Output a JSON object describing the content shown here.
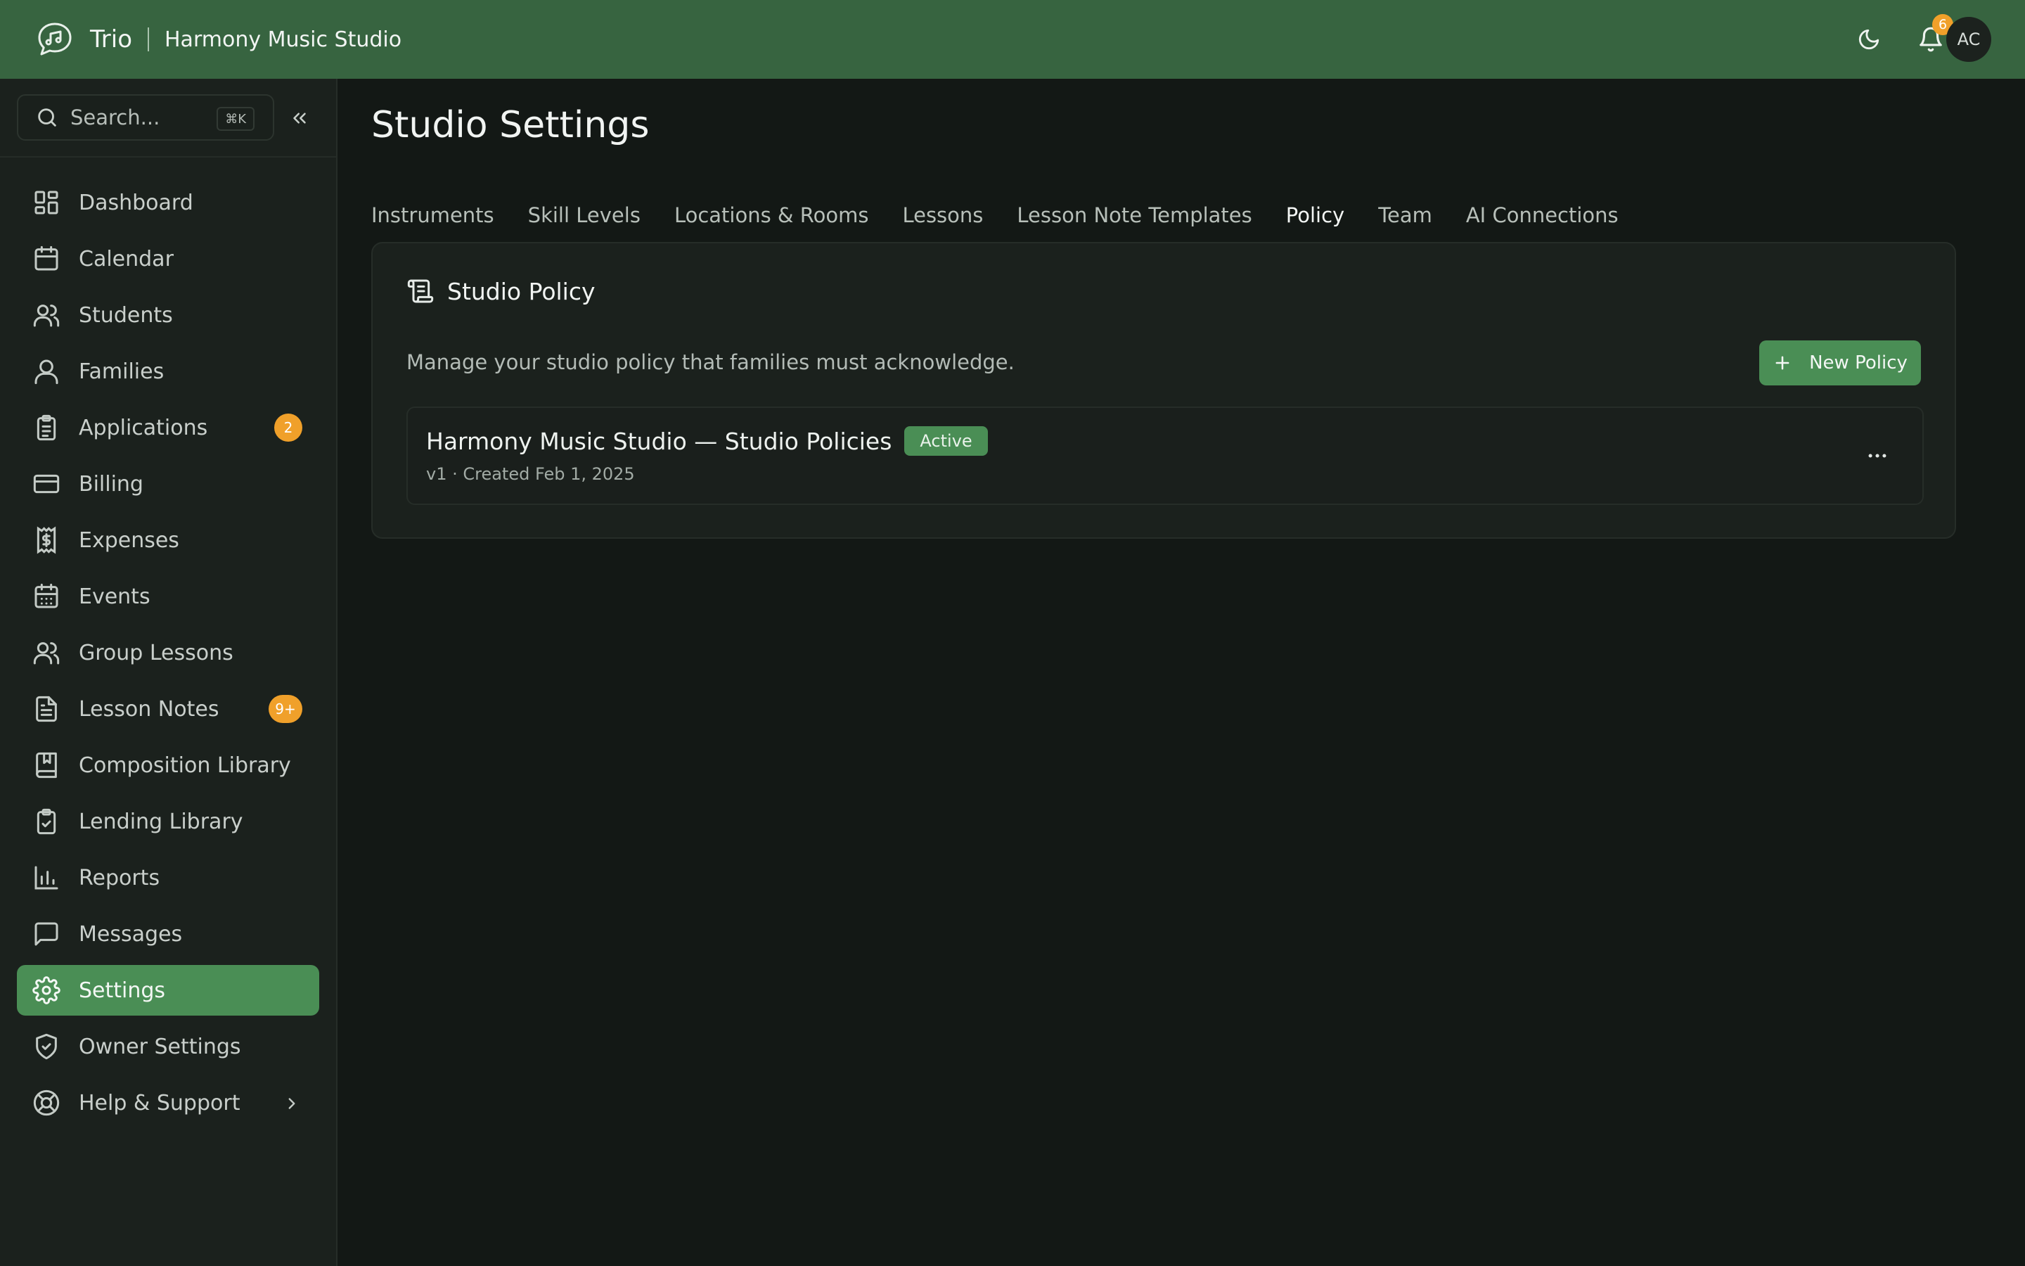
{
  "header": {
    "app_name": "Trio",
    "studio_name": "Harmony Music Studio",
    "notification_count": "6",
    "avatar_initials": "AC",
    "accent_color": "#376440"
  },
  "sidebar": {
    "search": {
      "placeholder": "Search...",
      "shortcut": "⌘K"
    },
    "items": [
      {
        "label": "Dashboard",
        "icon": "dashboard-icon"
      },
      {
        "label": "Calendar",
        "icon": "calendar-icon"
      },
      {
        "label": "Students",
        "icon": "students-icon"
      },
      {
        "label": "Families",
        "icon": "families-icon"
      },
      {
        "label": "Applications",
        "icon": "clipboard-icon",
        "badge": "2"
      },
      {
        "label": "Billing",
        "icon": "credit-card-icon"
      },
      {
        "label": "Expenses",
        "icon": "receipt-icon"
      },
      {
        "label": "Events",
        "icon": "calendar-grid-icon"
      },
      {
        "label": "Group Lessons",
        "icon": "group-icon"
      },
      {
        "label": "Lesson Notes",
        "icon": "document-icon",
        "badge": "9+"
      },
      {
        "label": "Composition Library",
        "icon": "book-icon"
      },
      {
        "label": "Lending Library",
        "icon": "clipboard-check-icon"
      },
      {
        "label": "Reports",
        "icon": "bar-chart-icon"
      },
      {
        "label": "Messages",
        "icon": "message-icon"
      },
      {
        "label": "Settings",
        "icon": "gear-icon",
        "active": true
      },
      {
        "label": "Owner Settings",
        "icon": "shield-check-icon"
      },
      {
        "label": "Help & Support",
        "icon": "lifebuoy-icon"
      }
    ]
  },
  "main": {
    "page_title": "Studio Settings",
    "tabs": [
      {
        "label": "Instruments"
      },
      {
        "label": "Skill Levels"
      },
      {
        "label": "Locations & Rooms"
      },
      {
        "label": "Lessons"
      },
      {
        "label": "Lesson Note Templates"
      },
      {
        "label": "Policy",
        "active": true
      },
      {
        "label": "Team"
      },
      {
        "label": "AI Connections"
      }
    ],
    "card": {
      "title": "Studio Policy",
      "description": "Manage your studio policy that families must acknowledge.",
      "new_button_label": "New Policy",
      "policies": [
        {
          "name": "Harmony Music Studio — Studio Policies",
          "status": "Active",
          "meta": "v1 · Created Feb 1, 2025"
        }
      ]
    }
  },
  "colors": {
    "active_green": "#4a8e55",
    "badge_orange": "#f0a02a",
    "background": "#131815",
    "sidebar_bg": "#1b211d"
  }
}
